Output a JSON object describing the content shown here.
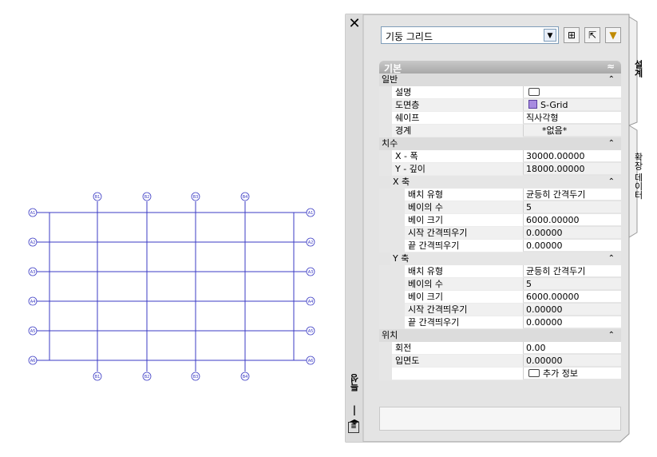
{
  "drawing": {
    "row_bubbles": [
      "A1",
      "A2",
      "A3",
      "A4",
      "A5",
      "A6"
    ],
    "col_bubbles": [
      "B1",
      "B2",
      "B3",
      "B4"
    ],
    "line_color": "#3b3bc4"
  },
  "palette": {
    "close_icon": "close-icon",
    "style_select": {
      "value": "기둥 그리드"
    },
    "toolbar": [
      {
        "name": "select-objects-icon"
      },
      {
        "name": "quick-select-icon"
      },
      {
        "name": "filter-icon"
      }
    ],
    "tabs": {
      "design": "설계",
      "extended_data": "확장 데이터"
    },
    "left_strip": {
      "label": "특성"
    },
    "section": {
      "title": "기본",
      "collapse": "≈"
    },
    "categories": [
      {
        "title": "일반",
        "toggle": "⌃",
        "rows": [
          {
            "label": "설명",
            "value": "",
            "icon": "message-icon"
          },
          {
            "label": "도면층",
            "value": "S-Grid",
            "icon": "layer-color-swatch"
          },
          {
            "label": "쉐이프",
            "value": "직사각형"
          },
          {
            "label": "경계",
            "value": "*없음*"
          }
        ]
      },
      {
        "title": "치수",
        "toggle": "⌃",
        "rows": [
          {
            "label": "X - 폭",
            "value": "30000.00000"
          },
          {
            "label": "Y - 깊이",
            "value": "18000.00000"
          }
        ],
        "subs": [
          {
            "title": "X 축",
            "toggle": "⌃",
            "rows": [
              {
                "label": "배치 유형",
                "value": "균등히 간격두기"
              },
              {
                "label": "베이의 수",
                "value": "5"
              },
              {
                "label": "베이 크기",
                "value": "6000.00000"
              },
              {
                "label": "시작 간격띄우기",
                "value": "0.00000"
              },
              {
                "label": "끝 간격띄우기",
                "value": "0.00000"
              }
            ]
          },
          {
            "title": "Y 축",
            "toggle": "⌃",
            "rows": [
              {
                "label": "배치 유형",
                "value": "균등히 간격두기"
              },
              {
                "label": "베이의 수",
                "value": "5"
              },
              {
                "label": "베이 크기",
                "value": "6000.00000"
              },
              {
                "label": "시작 간격띄우기",
                "value": "0.00000"
              },
              {
                "label": "끝 간격띄우기",
                "value": "0.00000"
              }
            ]
          }
        ]
      },
      {
        "title": "위치",
        "toggle": "⌃",
        "rows": [
          {
            "label": "회전",
            "value": "0.00"
          },
          {
            "label": "입면도",
            "value": "0.00000"
          },
          {
            "label": "",
            "value": "추가 정보",
            "icon": "message-icon"
          }
        ]
      }
    ]
  }
}
